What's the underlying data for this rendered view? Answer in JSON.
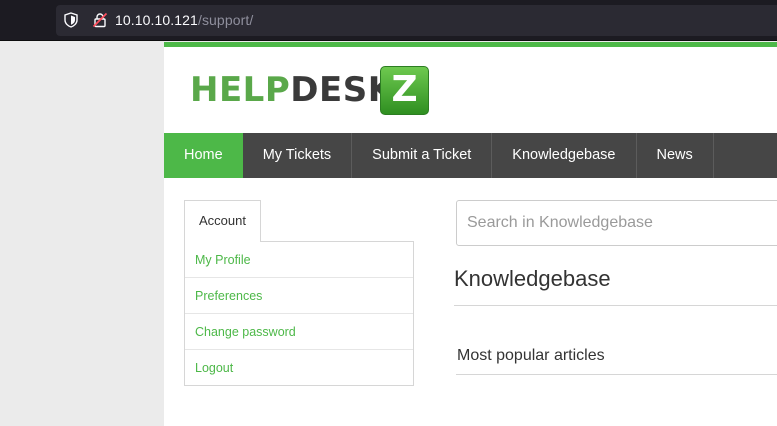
{
  "browser": {
    "url_host": "10.10.10.121",
    "url_path": "/support/"
  },
  "logo": {
    "part1": "HELP",
    "part2": "DESK",
    "badge": "Z"
  },
  "nav": {
    "items": [
      {
        "label": "Home",
        "active": true
      },
      {
        "label": "My Tickets",
        "active": false
      },
      {
        "label": "Submit a Ticket",
        "active": false
      },
      {
        "label": "Knowledgebase",
        "active": false
      },
      {
        "label": "News",
        "active": false
      }
    ]
  },
  "sidebar": {
    "tab_label": "Account",
    "links": [
      "My Profile",
      "Preferences",
      "Change password",
      "Logout"
    ]
  },
  "main": {
    "search_placeholder": "Search in Knowledgebase",
    "heading": "Knowledgebase",
    "popular_heading": "Most popular articles"
  },
  "colors": {
    "brand_green": "#4db848",
    "nav_bg": "#464646"
  }
}
